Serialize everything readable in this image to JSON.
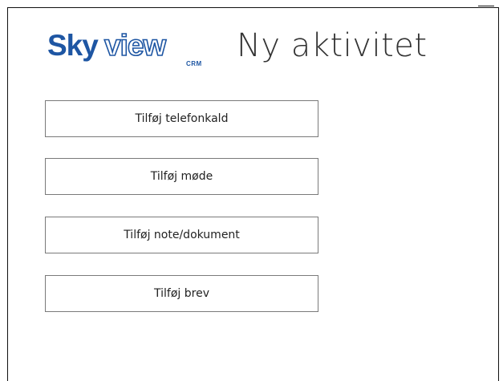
{
  "logo": {
    "part1": "Sky",
    "part2": "view",
    "sub": "CRM"
  },
  "title": "Ny aktivitet",
  "actions": [
    {
      "label": "Tilføj telefonkald"
    },
    {
      "label": "Tilføj møde"
    },
    {
      "label": "Tilføj note/dokument"
    },
    {
      "label": "Tilføj brev"
    }
  ],
  "colors": {
    "brand": "#1e56a3",
    "title_text": "#333333",
    "button_border": "#7a7a7a"
  }
}
